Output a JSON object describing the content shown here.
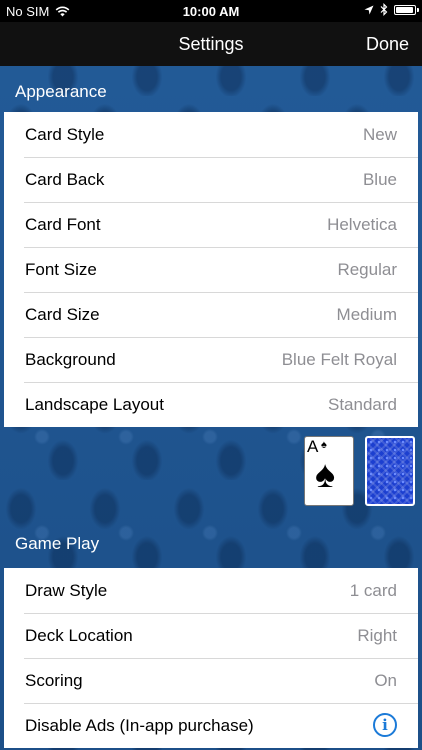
{
  "status_bar": {
    "carrier": "No SIM",
    "time": "10:00 AM",
    "icons": [
      "wifi-icon",
      "location-arrow-icon",
      "bluetooth-icon",
      "battery-icon"
    ]
  },
  "nav": {
    "title": "Settings",
    "done_label": "Done"
  },
  "appearance": {
    "header": "Appearance",
    "rows": [
      {
        "label": "Card Style",
        "value": "New"
      },
      {
        "label": "Card Back",
        "value": "Blue"
      },
      {
        "label": "Card Font",
        "value": "Helvetica"
      },
      {
        "label": "Font Size",
        "value": "Regular"
      },
      {
        "label": "Card Size",
        "value": "Medium"
      },
      {
        "label": "Background",
        "value": "Blue Felt Royal"
      },
      {
        "label": "Landscape Layout",
        "value": "Standard"
      }
    ]
  },
  "preview": {
    "card_rank": "A",
    "card_suit": "♠"
  },
  "game_play": {
    "header": "Game Play",
    "rows": [
      {
        "label": "Draw Style",
        "value": "1 card"
      },
      {
        "label": "Deck Location",
        "value": "Right"
      },
      {
        "label": "Scoring",
        "value": "On"
      },
      {
        "label": "Disable Ads (In-app purchase)",
        "icon": "info-icon"
      }
    ]
  },
  "colors": {
    "accent": "#1b7ad8",
    "background": "#1f5590",
    "navbar": "#111111",
    "secondary_text": "#8e8e93"
  }
}
